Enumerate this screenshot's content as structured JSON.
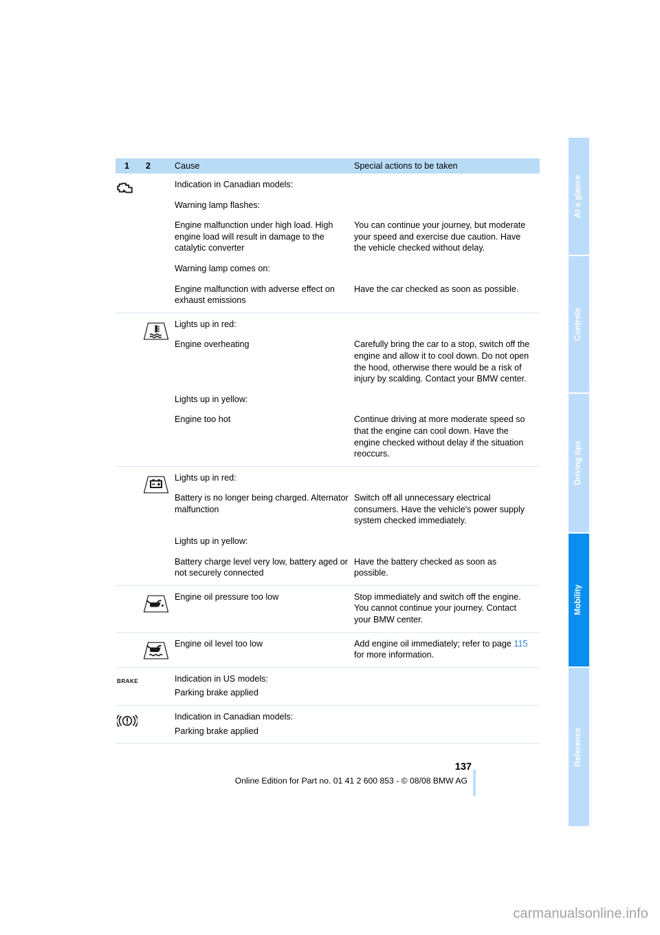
{
  "document": {
    "page_number": "137",
    "footer_note": "Online Edition for Part no. 01 41 2 600 853 - © 08/08 BMW AG",
    "watermark": "carmanualsonline.info"
  },
  "side_nav": {
    "tabs": [
      {
        "label": "At a glance",
        "active": false
      },
      {
        "label": "Controls",
        "active": false
      },
      {
        "label": "Driving tips",
        "active": false
      },
      {
        "label": "Mobility",
        "active": true
      },
      {
        "label": "Reference",
        "active": false
      }
    ],
    "colors": {
      "inactive_bg": "#bcdcfb",
      "active_bg": "#0a8ff0",
      "label": "#ffffff"
    }
  },
  "table": {
    "header": {
      "col1": "1",
      "col2": "2",
      "cause": "Cause",
      "action": "Special actions to be taken",
      "bg": "#b9dcf6"
    },
    "rows": [
      {
        "icon": "check-engine-icon",
        "blocks": [
          {
            "cause": "Indication in Canadian models:",
            "action": ""
          },
          {
            "cause": "Warning lamp flashes:",
            "action": ""
          },
          {
            "cause": "Engine malfunction under high load. High engine load will result in damage to the catalytic converter",
            "action": "You can continue your journey, but moderate your speed and exercise due caution. Have the vehicle checked without delay."
          },
          {
            "cause": "Warning lamp comes on:",
            "action": ""
          },
          {
            "cause": "Engine malfunction with adverse effect on exhaust emissions",
            "action": "Have the car checked as soon as possible."
          }
        ]
      },
      {
        "icon": "coolant-temperature-icon",
        "blocks": [
          {
            "cause": "Lights up in red:",
            "action": ""
          },
          {
            "cause": "Engine overheating",
            "action": "Carefully bring the car to a stop, switch off the engine and allow it to cool down. Do not open the hood, otherwise there would be a risk of injury by scalding. Contact your BMW center."
          },
          {
            "cause": "Lights up in yellow:",
            "action": ""
          },
          {
            "cause": "Engine too hot",
            "action": "Continue driving at more moderate speed so that the engine can cool down. Have the engine checked without delay if the situation reoccurs."
          }
        ]
      },
      {
        "icon": "battery-charge-icon",
        "blocks": [
          {
            "cause": "Lights up in red:",
            "action": ""
          },
          {
            "cause": "Battery is no longer being charged. Alternator malfunction",
            "action": "Switch off all unnecessary electrical consumers. Have the vehicle's power supply system checked immediately."
          },
          {
            "cause": "Lights up in yellow:",
            "action": ""
          },
          {
            "cause": "Battery charge level very low, battery aged or not securely connected",
            "action": "Have the battery checked as soon as possible."
          }
        ]
      },
      {
        "icon": "oil-pressure-icon",
        "blocks": [
          {
            "cause": "Engine oil pressure too low",
            "action": "Stop immediately and switch off the engine. You cannot continue your journey. Contact your BMW center."
          }
        ]
      },
      {
        "icon": "oil-level-icon",
        "blocks": [
          {
            "cause": "Engine oil level too low",
            "action_prefix": "Add engine oil immediately; refer to page ",
            "action_link": "115",
            "action_suffix": " for more information."
          }
        ]
      },
      {
        "icon": "brake-text-icon",
        "icon_text": "BRAKE",
        "blocks": [
          {
            "cause": "Indication in US models:",
            "action": ""
          },
          {
            "cause": "Parking brake applied",
            "action": ""
          }
        ]
      },
      {
        "icon": "parking-brake-icon",
        "blocks": [
          {
            "cause": "Indication in Canadian models:",
            "action": ""
          },
          {
            "cause": "Parking brake applied",
            "action": ""
          }
        ]
      }
    ]
  }
}
